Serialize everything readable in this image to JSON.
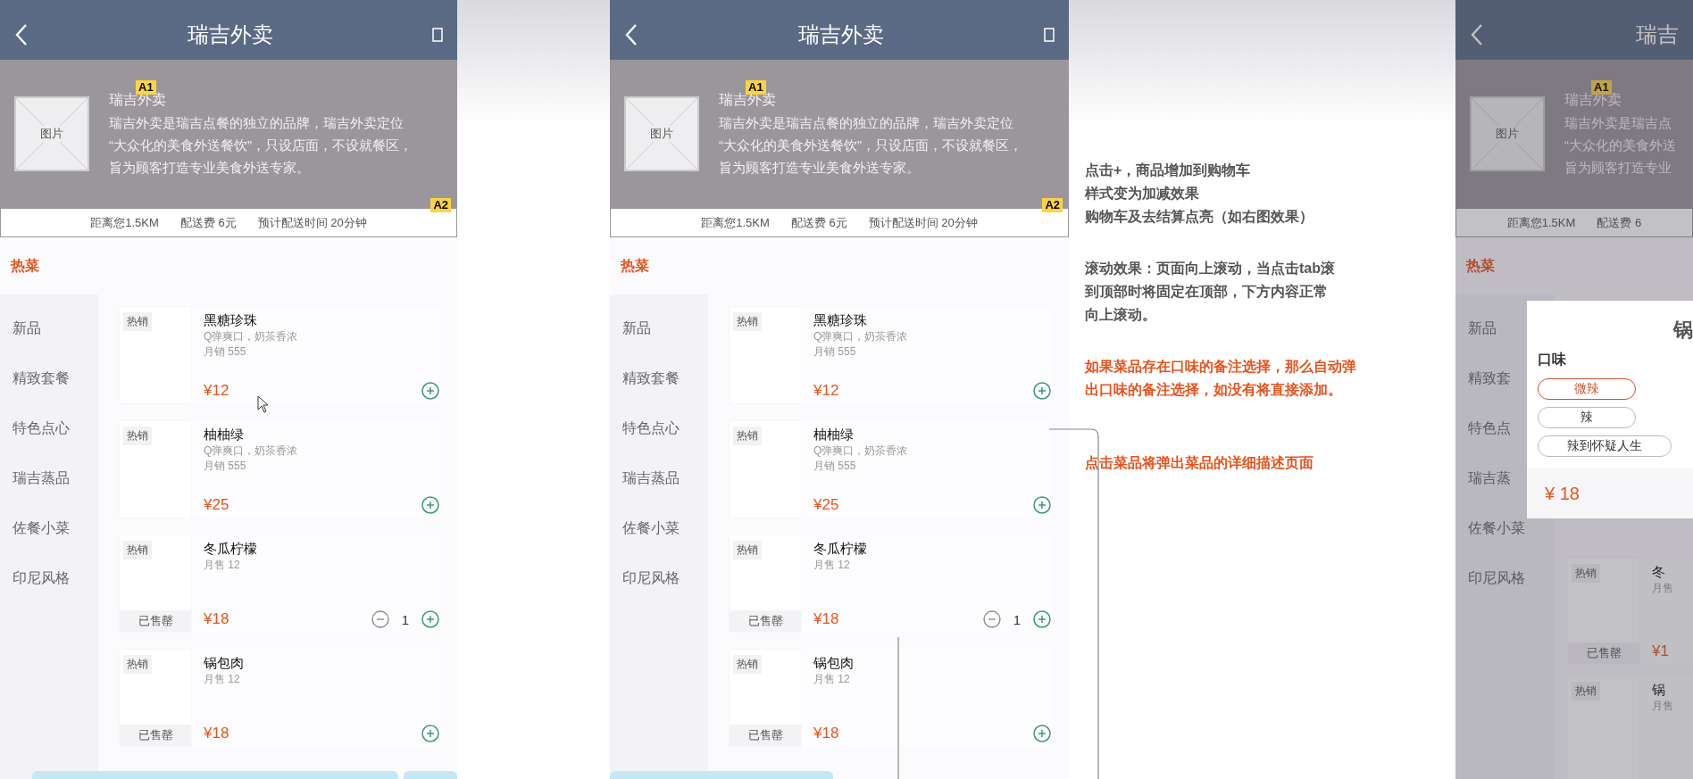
{
  "phones": [
    {
      "kind": "full",
      "title": "瑞吉外卖",
      "shop": {
        "image_label": "图片",
        "badge": "A1",
        "name": "瑞吉外卖",
        "description": [
          "瑞吉外卖是瑞吉点餐的独立的品牌，瑞吉外卖定位",
          "“大众化的美食外送餐饮”，只设店面，不设就餐区，",
          "旨为顾客打造专业美食外送专家。"
        ],
        "info_badge": "A2"
      },
      "info": [
        "距离您1.5KM",
        "配送费 6元",
        "预计配送时间 20分钟"
      ],
      "hot_tab": "热菜",
      "categories": [
        {
          "label": "新品",
          "selected": false
        },
        {
          "label": "精致套餐",
          "selected": false
        },
        {
          "label": "特色点心",
          "selected": false
        },
        {
          "label": "瑞吉蒸品",
          "selected": false
        },
        {
          "label": "佐餐小菜",
          "selected": false
        },
        {
          "label": "印尼风格",
          "selected": false
        }
      ],
      "items": [
        {
          "tag": "热销",
          "name": "黑糖珍珠",
          "desc": "Q弹爽口，奶茶香浓",
          "sales": "月销 555",
          "price": "¥12"
        },
        {
          "tag": "热销",
          "name": "柚柚绿",
          "desc": "Q弹爽口，奶茶香浓",
          "sales": "月销 555",
          "price": "¥25"
        },
        {
          "tag": "热销",
          "name": "冬瓜柠檬",
          "sales": "月售 12",
          "sold_out": "已售罄",
          "price": "¥18",
          "quantity": "1"
        },
        {
          "tag": "热销",
          "name": "锅包肉",
          "sales": "月售 12",
          "sold_out": "已售罄",
          "price": "¥18"
        }
      ]
    },
    {
      "kind": "full",
      "title": "瑞吉外卖",
      "shop": {
        "image_label": "图片",
        "badge": "A1",
        "name": "瑞吉外卖",
        "description": [
          "瑞吉外卖是瑞吉点餐的独立的品牌，瑞吉外卖定位",
          "“大众化的美食外送餐饮”，只设店面，不设就餐区，",
          "旨为顾客打造专业美食外送专家。"
        ],
        "info_badge": "A2"
      },
      "info": [
        "距离您1.5KM",
        "配送费 6元",
        "预计配送时间 20分钟"
      ],
      "hot_tab": "热菜",
      "categories": [
        {
          "label": "新品",
          "selected": false
        },
        {
          "label": "精致套餐",
          "selected": false
        },
        {
          "label": "特色点心",
          "selected": false
        },
        {
          "label": "瑞吉蒸品",
          "selected": false
        },
        {
          "label": "佐餐小菜",
          "selected": false
        },
        {
          "label": "印尼风格",
          "selected": false
        }
      ],
      "items": [
        {
          "tag": "热销",
          "name": "黑糖珍珠",
          "desc": "Q弹爽口，奶茶香浓",
          "sales": "月销 555",
          "price": "¥12"
        },
        {
          "tag": "热销",
          "name": "柚柚绿",
          "desc": "Q弹爽口，奶茶香浓",
          "sales": "月销 555",
          "price": "¥25"
        },
        {
          "tag": "热销",
          "name": "冬瓜柠檬",
          "sales": "月售 12",
          "sold_out": "已售罄",
          "price": "¥18",
          "quantity": "1"
        },
        {
          "tag": "热销",
          "name": "锅包肉",
          "sales": "月售 12",
          "sold_out": "已售罄",
          "price": "¥18"
        }
      ]
    },
    {
      "kind": "partial",
      "title": "瑞吉",
      "shop": {
        "image_label": "图片",
        "badge": "A1",
        "name": "瑞吉外卖",
        "description": [
          "瑞吉外卖是瑞吉点",
          "“大众化的美食外送",
          "旨为顾客打造专业"
        ]
      },
      "info": [
        "距离您1.5KM",
        "配送费 6"
      ],
      "hot_tab": "热菜",
      "categories": [
        {
          "label": "新品",
          "selected": false
        },
        {
          "label": "精致套",
          "selected": false
        },
        {
          "label": "特色点",
          "selected": false
        },
        {
          "label": "瑞吉蒸",
          "selected": false
        },
        {
          "label": "佐餐小菜",
          "selected": false
        },
        {
          "label": "印尼风格",
          "selected": false
        }
      ],
      "items": [
        {
          "tag": "热销",
          "name": "冬",
          "sales": "月售",
          "sold_out": "已售罄",
          "price": "¥1"
        },
        {
          "tag": "热销",
          "name": "锅",
          "sales": "月售"
        }
      ],
      "popup": {
        "title": "锅",
        "label": "口味",
        "options": [
          {
            "label": "微辣",
            "selected": true
          },
          {
            "label": "辣",
            "selected": false
          },
          {
            "label": "辣到怀疑人生",
            "selected": false
          }
        ],
        "price": "¥ 18"
      }
    }
  ],
  "notes": [
    {
      "kind": "info",
      "lines": [
        "点击+，商品增加到购物车",
        "样式变为加减效果",
        "购物车及去结算点亮（如右图效果）"
      ]
    },
    {
      "kind": "info",
      "lines": [
        "滚动效果：页面向上滚动，当点击tab滚",
        "到顶部时将固定在顶部，下方内容正常",
        "向上滚动。"
      ]
    },
    {
      "kind": "rule",
      "lines": [
        "如果菜品存在口味的备注选择，那么自动弹",
        "出口味的备注选择，如没有将直接添加。"
      ]
    },
    {
      "kind": "rule",
      "lines": [
        "点击菜品将弹出菜品的详细描述页面"
      ]
    }
  ]
}
